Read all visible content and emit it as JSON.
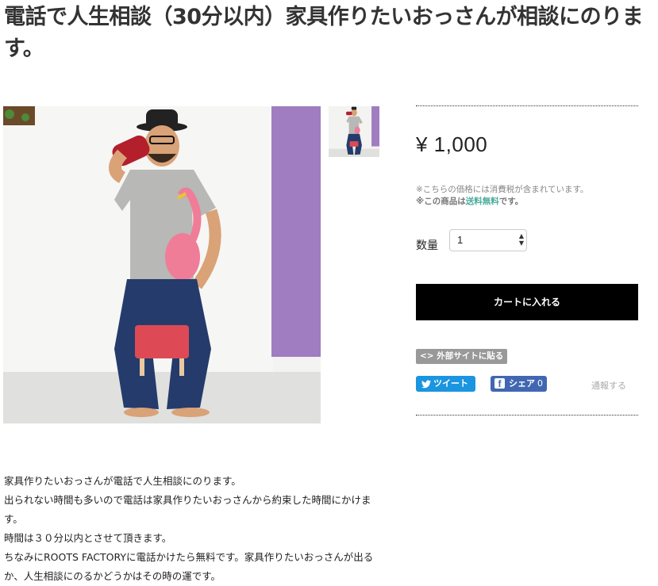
{
  "product": {
    "title": "電話で人生相談（30分以内）家具作りたいおっさんが相談にのります。",
    "price": "¥ 1,000",
    "tax_note": "※こちらの価格には消費税が含まれています。",
    "shipping_prefix": "※この商品は",
    "shipping_link": "送料無料",
    "shipping_suffix": "です。",
    "quantity_label": "数量",
    "quantity_value": "1",
    "cart_button": "カートに入れる",
    "embed_label": "<> 外部サイトに貼る",
    "tweet_label": "ツイート",
    "share_label": "シェア",
    "share_count": "0",
    "report_label": "通報する"
  },
  "description": [
    "家具作りたいおっさんが電話で人生相談にのります。",
    "出られない時間も多いので電話は家具作りたいおっさんから約束した時間にかけます。",
    "時間は３０分以内とさせて頂きます。",
    "ちなみにROOTS FACTORYに電話かけたら無料です。家具作りたいおっさんが出るか、人生相談にのるかどうかはその時の運です。"
  ],
  "colors": {
    "shipping_link": "#4aab9a",
    "tweet": "#1b95e0",
    "share": "#4267b2",
    "cart": "#000000",
    "wall_purple": "#a07cc0"
  }
}
